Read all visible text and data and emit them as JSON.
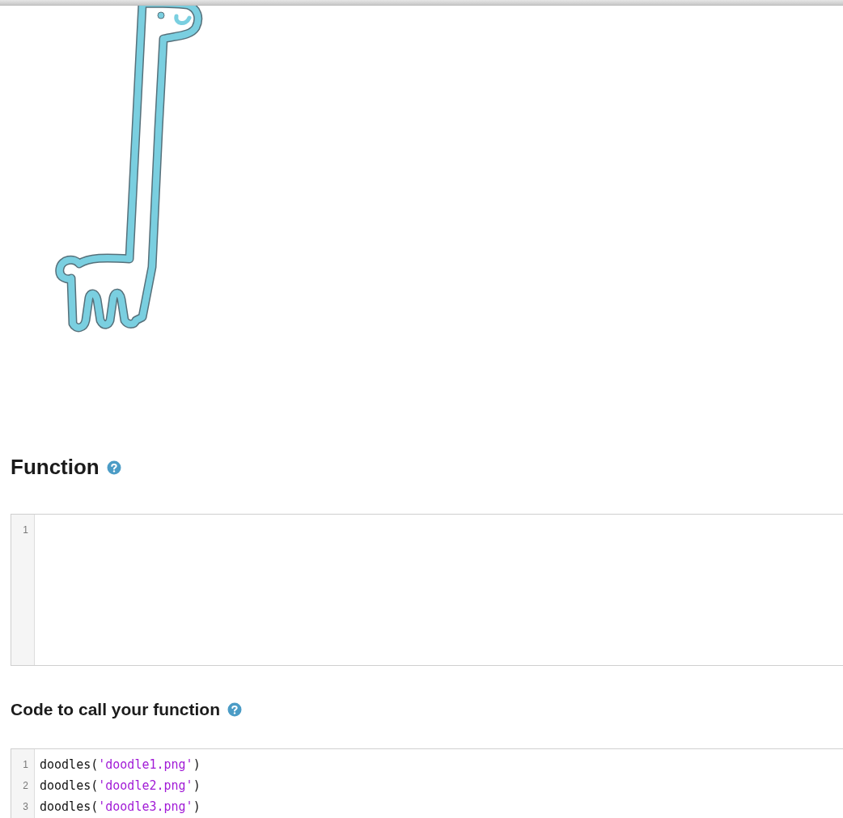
{
  "sections": [
    {
      "heading": "Function",
      "editor": {
        "lines": [
          {
            "number": "1"
          }
        ]
      }
    },
    {
      "heading": "Code to call your function",
      "editor": {
        "lines": [
          {
            "number": "1",
            "tokens": [
              {
                "kind": "plain",
                "text": "doodles("
              },
              {
                "kind": "string",
                "text": "'doodle1.png'"
              },
              {
                "kind": "plain",
                "text": ")"
              }
            ]
          },
          {
            "number": "2",
            "tokens": [
              {
                "kind": "plain",
                "text": "doodles("
              },
              {
                "kind": "string",
                "text": "'doodle2.png'"
              },
              {
                "kind": "plain",
                "text": ")"
              }
            ]
          },
          {
            "number": "3",
            "tokens": [
              {
                "kind": "plain",
                "text": "doodles("
              },
              {
                "kind": "string",
                "text": "'doodle3.png'"
              },
              {
                "kind": "plain",
                "text": ")"
              }
            ]
          }
        ]
      }
    }
  ]
}
